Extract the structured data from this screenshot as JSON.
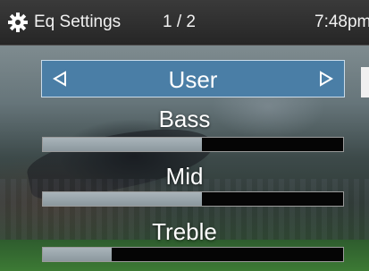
{
  "status_bar": {
    "icon": "gear-icon",
    "title": "Eq Settings",
    "page_indicator": "1 / 2",
    "time": "7:48pm"
  },
  "preset": {
    "value": "User",
    "prev_icon": "triangle-left-icon",
    "next_icon": "triangle-right-icon"
  },
  "sliders": [
    {
      "label": "Bass",
      "level": 0.53
    },
    {
      "label": "Mid",
      "level": 0.53
    },
    {
      "label": "Treble",
      "level": 0.23
    }
  ],
  "colors": {
    "selector_background": "#4a7ea6",
    "slider_fill": "#9aa5ab",
    "slider_track": "#050505"
  }
}
